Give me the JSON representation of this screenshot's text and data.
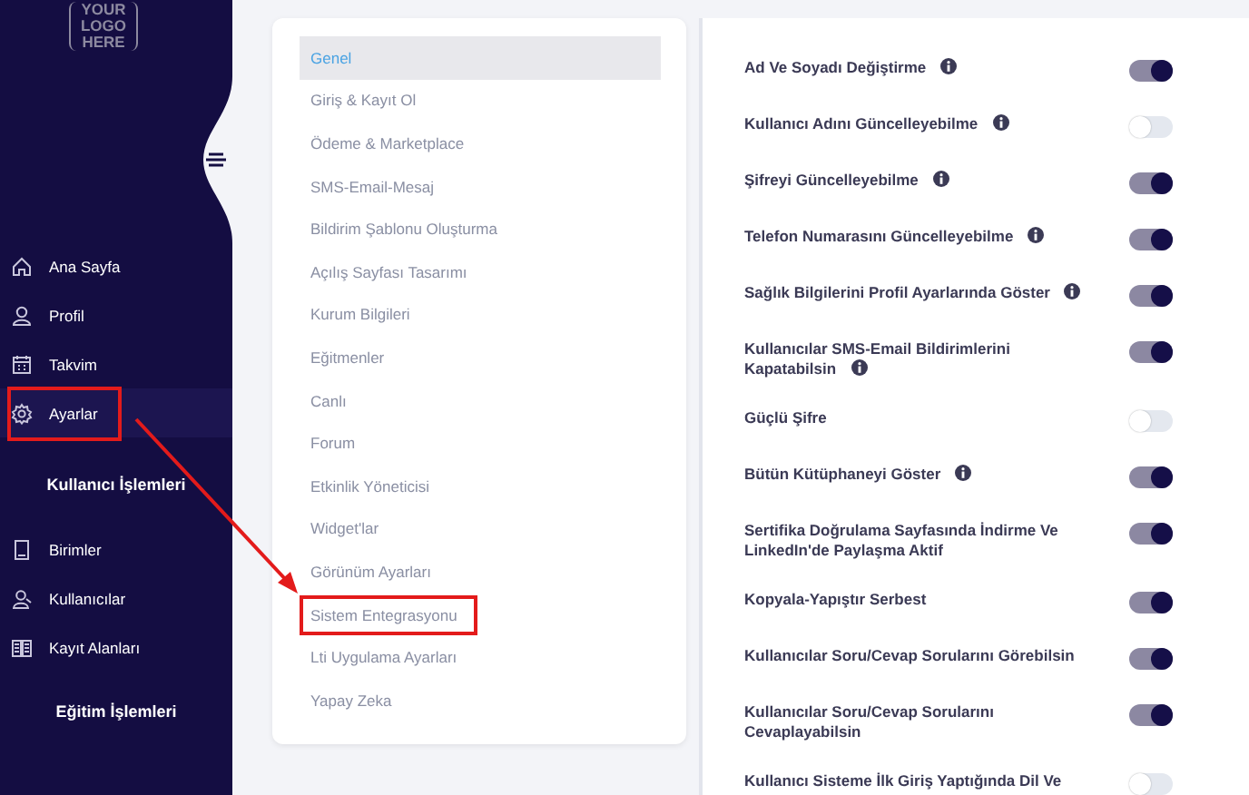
{
  "sidebar": {
    "logo": [
      "YOUR",
      "LOGO",
      "HERE"
    ],
    "sections": [
      {
        "items": [
          {
            "label": "Ana Sayfa",
            "selected": false,
            "annotated": false
          },
          {
            "label": "Profil",
            "selected": false,
            "annotated": false
          },
          {
            "label": "Takvim",
            "selected": false,
            "annotated": false
          },
          {
            "label": "Ayarlar",
            "selected": true,
            "annotated": true
          }
        ]
      },
      {
        "heading": "Kullanıcı İşlemleri",
        "items": [
          {
            "label": "Birimler",
            "selected": false,
            "annotated": false
          },
          {
            "label": "Kullanıcılar",
            "selected": false,
            "annotated": false
          },
          {
            "label": "Kayıt Alanları",
            "selected": false,
            "annotated": false
          }
        ]
      },
      {
        "heading": "Eğitim İşlemleri"
      }
    ]
  },
  "settings_menu": [
    {
      "label": "Genel",
      "selected": true,
      "annotated": false
    },
    {
      "label": "Giriş & Kayıt Ol",
      "selected": false,
      "annotated": false
    },
    {
      "label": "Ödeme & Marketplace",
      "selected": false,
      "annotated": false
    },
    {
      "label": "SMS-Email-Mesaj",
      "selected": false,
      "annotated": false
    },
    {
      "label": "Bildirim Şablonu Oluşturma",
      "selected": false,
      "annotated": false
    },
    {
      "label": "Açılış Sayfası Tasarımı",
      "selected": false,
      "annotated": false
    },
    {
      "label": "Kurum Bilgileri",
      "selected": false,
      "annotated": false
    },
    {
      "label": "Eğitmenler",
      "selected": false,
      "annotated": false
    },
    {
      "label": "Canlı",
      "selected": false,
      "annotated": false
    },
    {
      "label": "Forum",
      "selected": false,
      "annotated": false
    },
    {
      "label": "Etkinlik Yöneticisi",
      "selected": false,
      "annotated": false
    },
    {
      "label": "Widget'lar",
      "selected": false,
      "annotated": false
    },
    {
      "label": "Görünüm Ayarları",
      "selected": false,
      "annotated": false
    },
    {
      "label": "Sistem Entegrasyonu",
      "selected": false,
      "annotated": true
    },
    {
      "label": "Lti Uygulama Ayarları",
      "selected": false,
      "annotated": false
    },
    {
      "label": "Yapay Zeka",
      "selected": false,
      "annotated": false
    }
  ],
  "settings": [
    {
      "lines": [
        "Ad Ve Soyadı Değiştirme"
      ],
      "info": true,
      "on": true
    },
    {
      "lines": [
        "Kullanıcı Adını Güncelleyebilme"
      ],
      "info": true,
      "on": false
    },
    {
      "lines": [
        "Şifreyi Güncelleyebilme"
      ],
      "info": true,
      "on": true
    },
    {
      "lines": [
        "Telefon Numarasını Güncelleyebilme"
      ],
      "info": true,
      "on": true
    },
    {
      "lines": [
        "Sağlık Bilgilerini Profil Ayarlarında Göster"
      ],
      "info": true,
      "on": true
    },
    {
      "lines": [
        "Kullanıcılar SMS-Email Bildirimlerini",
        "Kapatabilsin"
      ],
      "info": true,
      "on": true
    },
    {
      "lines": [
        "Güçlü Şifre"
      ],
      "info": false,
      "on": false
    },
    {
      "lines": [
        "Bütün Kütüphaneyi Göster"
      ],
      "info": true,
      "on": true
    },
    {
      "lines": [
        "Sertifika Doğrulama Sayfasında İndirme Ve",
        "LinkedIn'de Paylaşma Aktif"
      ],
      "info": false,
      "on": true
    },
    {
      "lines": [
        "Kopyala-Yapıştır Serbest"
      ],
      "info": false,
      "on": true
    },
    {
      "lines": [
        "Kullanıcılar Soru/Cevap Sorularını Görebilsin"
      ],
      "info": false,
      "on": true
    },
    {
      "lines": [
        "Kullanıcılar Soru/Cevap Sorularını",
        "Cevaplayabilsin"
      ],
      "info": false,
      "on": true
    },
    {
      "lines": [
        "Kullanıcı Sisteme İlk Giriş Yaptığında Dil Ve"
      ],
      "info": false,
      "on": false
    }
  ]
}
